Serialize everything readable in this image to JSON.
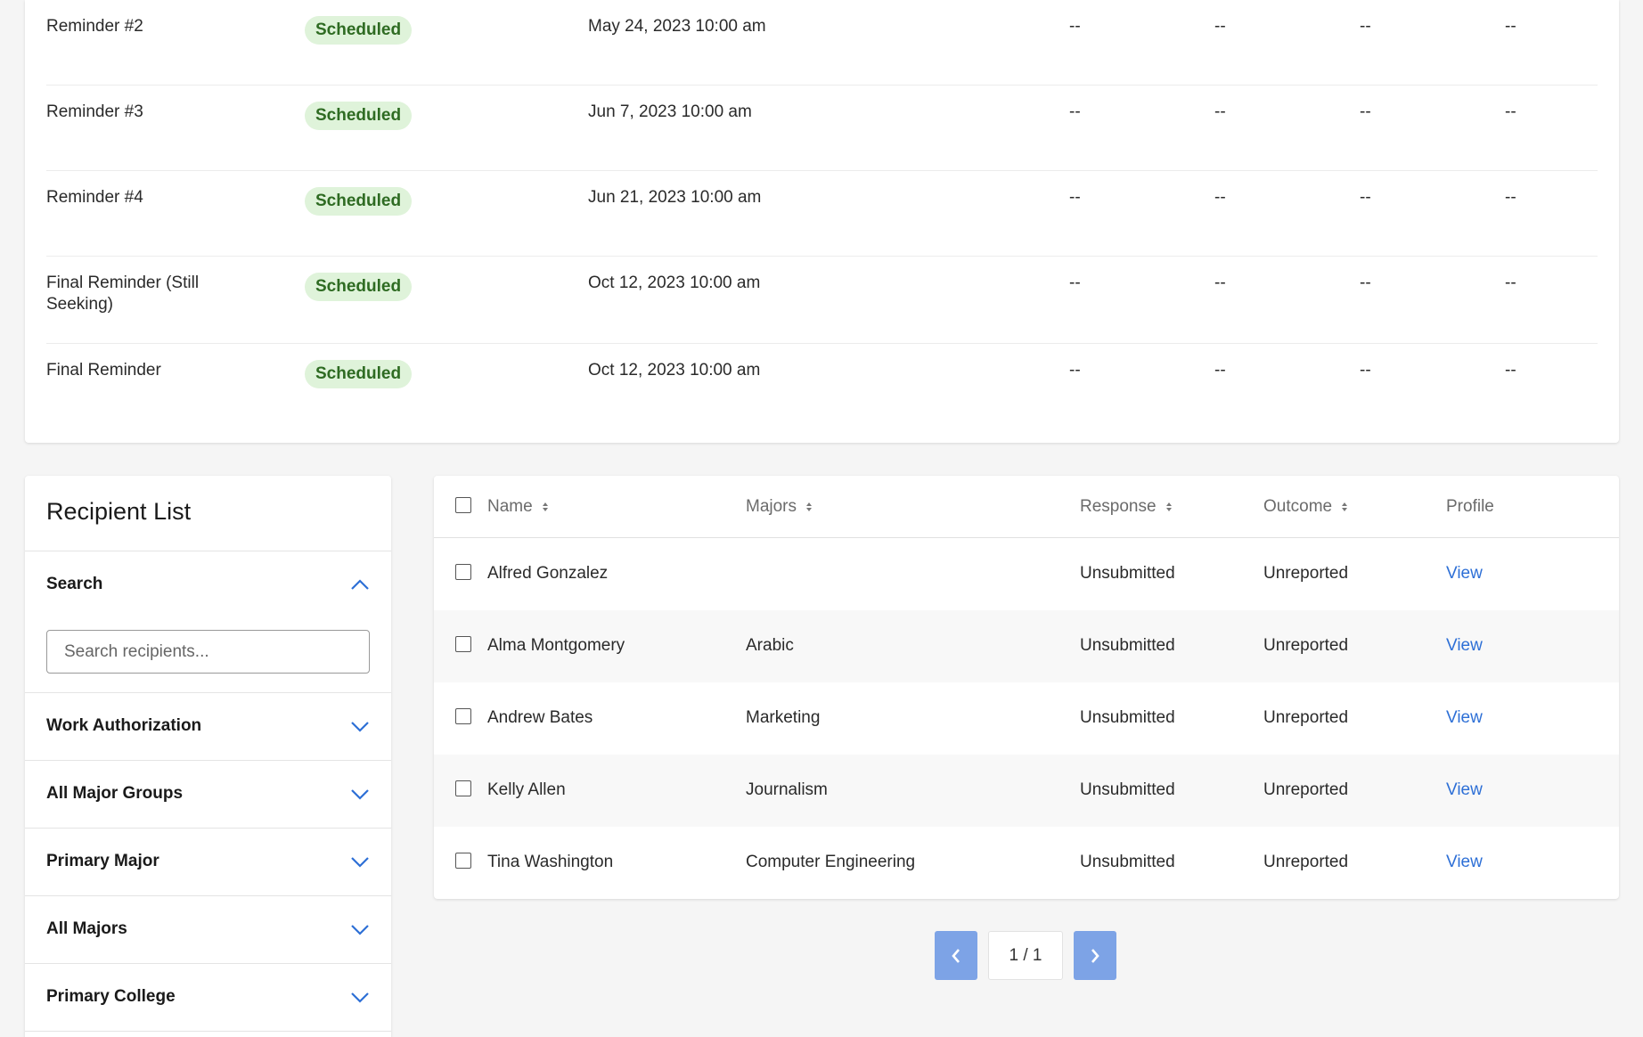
{
  "reminders": [
    {
      "name": "Reminder #2",
      "status": "Scheduled",
      "date": "May 24, 2023 10:00 am",
      "cols": [
        "--",
        "--",
        "--",
        "--"
      ]
    },
    {
      "name": "Reminder #3",
      "status": "Scheduled",
      "date": "Jun 7, 2023 10:00 am",
      "cols": [
        "--",
        "--",
        "--",
        "--"
      ]
    },
    {
      "name": "Reminder #4",
      "status": "Scheduled",
      "date": "Jun 21, 2023 10:00 am",
      "cols": [
        "--",
        "--",
        "--",
        "--"
      ]
    },
    {
      "name": "Final Reminder (Still Seeking)",
      "status": "Scheduled",
      "date": "Oct 12, 2023 10:00 am",
      "cols": [
        "--",
        "--",
        "--",
        "--"
      ]
    },
    {
      "name": "Final Reminder",
      "status": "Scheduled",
      "date": "Oct 12, 2023 10:00 am",
      "cols": [
        "--",
        "--",
        "--",
        "--"
      ]
    }
  ],
  "filters": {
    "title": "Recipient List",
    "search": {
      "label": "Search",
      "placeholder": "Search recipients..."
    },
    "sections": [
      "Work Authorization",
      "All Major Groups",
      "Primary Major",
      "All Majors",
      "Primary College"
    ]
  },
  "table": {
    "headers": {
      "name": "Name",
      "majors": "Majors",
      "response": "Response",
      "outcome": "Outcome",
      "profile": "Profile"
    },
    "rows": [
      {
        "name": "Alfred Gonzalez",
        "major": "",
        "response": "Unsubmitted",
        "outcome": "Unreported",
        "profile": "View"
      },
      {
        "name": "Alma Montgomery",
        "major": "Arabic",
        "response": "Unsubmitted",
        "outcome": "Unreported",
        "profile": "View"
      },
      {
        "name": "Andrew Bates",
        "major": "Marketing",
        "response": "Unsubmitted",
        "outcome": "Unreported",
        "profile": "View"
      },
      {
        "name": "Kelly Allen",
        "major": "Journalism",
        "response": "Unsubmitted",
        "outcome": "Unreported",
        "profile": "View"
      },
      {
        "name": "Tina Washington",
        "major": "Computer Engineering",
        "response": "Unsubmitted",
        "outcome": "Unreported",
        "profile": "View"
      }
    ]
  },
  "pagination": {
    "indicator": "1 / 1"
  },
  "colors": {
    "accent": "#2d6fd6",
    "badge_bg": "#dff3da",
    "badge_text": "#2e6b22",
    "pager_button": "#7da3e6"
  }
}
